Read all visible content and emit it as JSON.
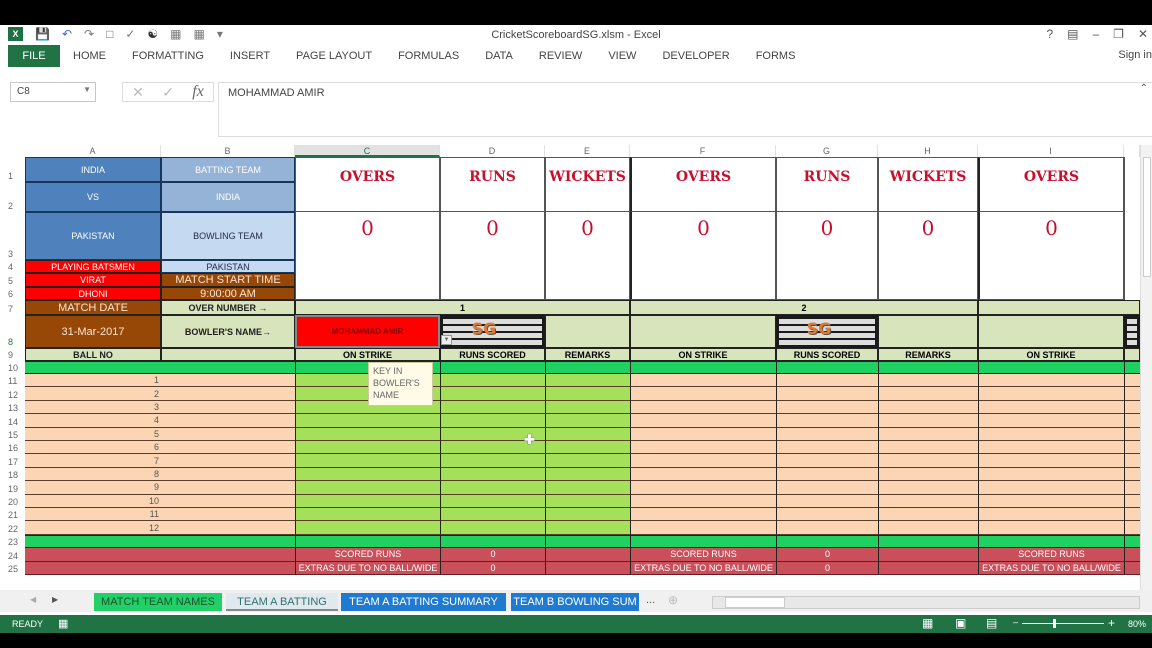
{
  "app": {
    "title": "CricketScoreboardSG.xlsm - Excel",
    "sign_in": "Sign in"
  },
  "ribbon": {
    "tabs": [
      "FILE",
      "HOME",
      "FORMATTING",
      "INSERT",
      "PAGE LAYOUT",
      "FORMULAS",
      "DATA",
      "REVIEW",
      "VIEW",
      "DEVELOPER",
      "FORMS"
    ]
  },
  "formula_bar": {
    "name_box": "C8",
    "formula": "MOHAMMAD AMIR",
    "fx": "fx"
  },
  "columns": [
    "A",
    "B",
    "C",
    "D",
    "E",
    "F",
    "G",
    "H",
    "I"
  ],
  "rows": [
    "1",
    "2",
    "3",
    "4",
    "5",
    "6",
    "7",
    "8",
    "9",
    "10",
    "11",
    "12",
    "13",
    "14",
    "15",
    "16",
    "17",
    "18",
    "19",
    "20",
    "21",
    "22",
    "23",
    "24",
    "25"
  ],
  "sheet": {
    "a1": "INDIA",
    "a2": "VS",
    "a3": "PAKISTAN",
    "a4": "PLAYING BATSMEN",
    "a5": "VIRAT",
    "a6": "DHONI",
    "a7": "MATCH DATE",
    "a8": "31-Mar-2017",
    "a9": "BALL NO",
    "b1": "BATTING TEAM",
    "b2": "INDIA",
    "b3": "BOWLING TEAM",
    "b4": "PAKISTAN",
    "b5": "MATCH START TIME",
    "b6": "9:00:00 AM",
    "b7": "OVER NUMBER →",
    "b8": "BOWLER'S NAME→",
    "ball_numbers": [
      "1",
      "2",
      "3",
      "4",
      "5",
      "6",
      "7",
      "8",
      "9",
      "10",
      "11",
      "12"
    ],
    "scoreboard": [
      {
        "label": "OVERS",
        "value": "0"
      },
      {
        "label": "RUNS",
        "value": "0"
      },
      {
        "label": "WICKETS",
        "value": "0"
      },
      {
        "label": "OVERS",
        "value": "0"
      },
      {
        "label": "RUNS",
        "value": "0"
      },
      {
        "label": "WICKETS",
        "value": "0"
      },
      {
        "label": "OVERS",
        "value": "0"
      }
    ],
    "over1": "1",
    "over2": "2",
    "bowler1": "MOHAMMAD AMIR",
    "sub_headers": {
      "on_strike": "ON STRIKE",
      "runs_scored": "RUNS SCORED",
      "remarks": "REMARKS"
    },
    "scored_runs": "SCORED RUNS",
    "extras": "EXTRAS DUE TO NO BALL/WIDE",
    "zero": "0",
    "logo": "SG"
  },
  "tooltip": "KEY IN BOWLER'S NAME",
  "sheet_tabs": [
    "MATCH TEAM NAMES",
    "TEAM A BATTING",
    "TEAM A BATTING SUMMARY",
    "TEAM B BOWLING SUM"
  ],
  "sheet_more": "...",
  "status": {
    "ready": "READY",
    "zoom": "80%"
  }
}
